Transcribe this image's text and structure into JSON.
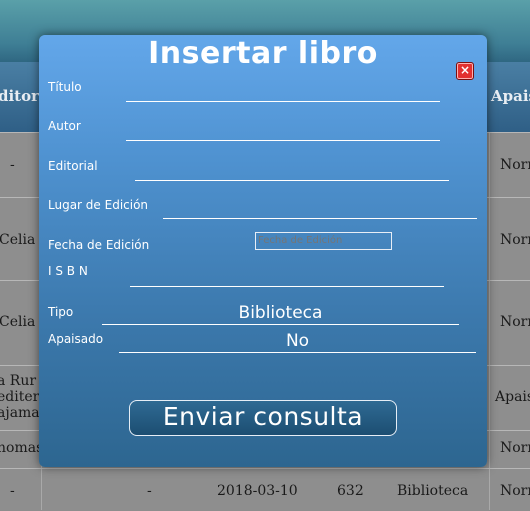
{
  "background": {
    "header_cells": [
      "ditoria",
      "Apais"
    ],
    "rows": [
      {
        "c0": "-",
        "c1": "",
        "c2": "",
        "c3": "",
        "c4": "",
        "c5": "Norn"
      },
      {
        "c0": "Celia V",
        "c1": "",
        "c2": "",
        "c3": "",
        "c4": "",
        "c5": "Norn"
      },
      {
        "c0": "Celia V",
        "c1": "",
        "c2": "",
        "c3": "",
        "c4": "",
        "c5": "Norn"
      },
      {
        "c0": "a Rur\nediter\najamal",
        "c1": "",
        "c2": "",
        "c3": "",
        "c4": "",
        "c5": "Apais"
      },
      {
        "c0": "homas",
        "c1": "",
        "c2": "",
        "c3": "",
        "c4": "",
        "c5": "Norn"
      },
      {
        "c0": "-",
        "c1": "-",
        "c2": "2018-03-10",
        "c3": "632",
        "c4": "Biblioteca",
        "c5": "Norn"
      }
    ]
  },
  "modal": {
    "title": "Insertar libro",
    "close_label": "×",
    "fields": {
      "titulo": {
        "label": "Título",
        "value": ""
      },
      "autor": {
        "label": "Autor",
        "value": ""
      },
      "editorial": {
        "label": "Editorial",
        "value": ""
      },
      "lugar": {
        "label": "Lugar de Edición",
        "value": ""
      },
      "fecha": {
        "label": "Fecha de Edición",
        "placeholder": "Fecha de Edición"
      },
      "isbn": {
        "label": "I S B N",
        "value": ""
      },
      "tipo": {
        "label": "Tipo",
        "selected": "Biblioteca"
      },
      "apaisado": {
        "label": "Apaisado",
        "selected": "No"
      }
    },
    "submit_label": "Enviar consulta"
  },
  "colors": {
    "modal_top": "#63a7ea",
    "modal_bottom": "#2d6690",
    "close_button": "#e23030"
  }
}
